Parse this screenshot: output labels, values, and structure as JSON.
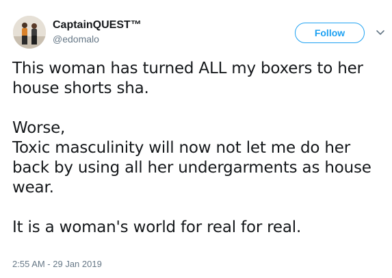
{
  "user": {
    "display_name": "CaptainQUEST™",
    "handle": "@edomalo"
  },
  "follow_button": {
    "label": "Follow"
  },
  "tweet": {
    "text": "This woman has turned ALL my boxers to her house shorts sha.\n\nWorse,\nToxic masculinity will now not let me do her back by using all her undergarments as house wear.\n\nIt is a woman's world for real for real.",
    "timestamp": "2:55 AM - 29 Jan 2019"
  },
  "icons": {
    "avatar": "profile-photo",
    "menu": "chevron-down-icon"
  },
  "colors": {
    "accent": "#1da1f2",
    "text": "#14171a",
    "secondary": "#657786"
  }
}
